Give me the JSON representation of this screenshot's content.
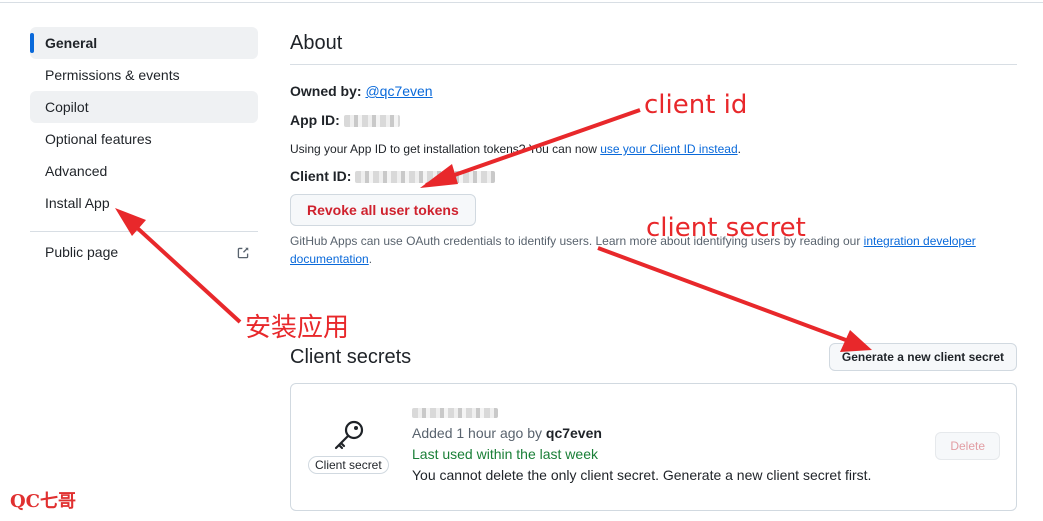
{
  "sidebar": {
    "items": [
      {
        "label": "General"
      },
      {
        "label": "Permissions & events"
      },
      {
        "label": "Copilot"
      },
      {
        "label": "Optional features"
      },
      {
        "label": "Advanced"
      },
      {
        "label": "Install App"
      }
    ],
    "public_page": "Public page"
  },
  "about": {
    "title": "About",
    "owned_by_label": "Owned by:",
    "owner": "@qc7even",
    "app_id_label": "App ID:",
    "notice_prefix": "Using your App ID to get installation tokens? You can now",
    "notice_link": "use your Client ID instead",
    "notice_suffix": ".",
    "client_id_label": "Client ID:",
    "revoke_button": "Revoke all user tokens",
    "oauth_text": "GitHub Apps can use OAuth credentials to identify users. Learn more about identifying users by reading our",
    "oauth_link_1": "integration developer",
    "oauth_link_2": "documentation",
    "oauth_suffix": "."
  },
  "secrets": {
    "title": "Client secrets",
    "generate_button": "Generate a new client secret",
    "item": {
      "badge": "Client secret",
      "added": "Added 1 hour ago by",
      "added_by": "qc7even",
      "last_used": "Last used within the last week",
      "warning": "You cannot delete the only client secret. Generate a new client secret first.",
      "delete_button": "Delete"
    }
  },
  "annotations": {
    "client_id": "client id",
    "client_secret": "client secret",
    "install_app": "安装应用",
    "watermark": "QC七哥",
    "color": "#e8282b"
  },
  "colors": {
    "accent": "#0969da",
    "danger": "#cf222e",
    "success": "#1a7f37"
  }
}
